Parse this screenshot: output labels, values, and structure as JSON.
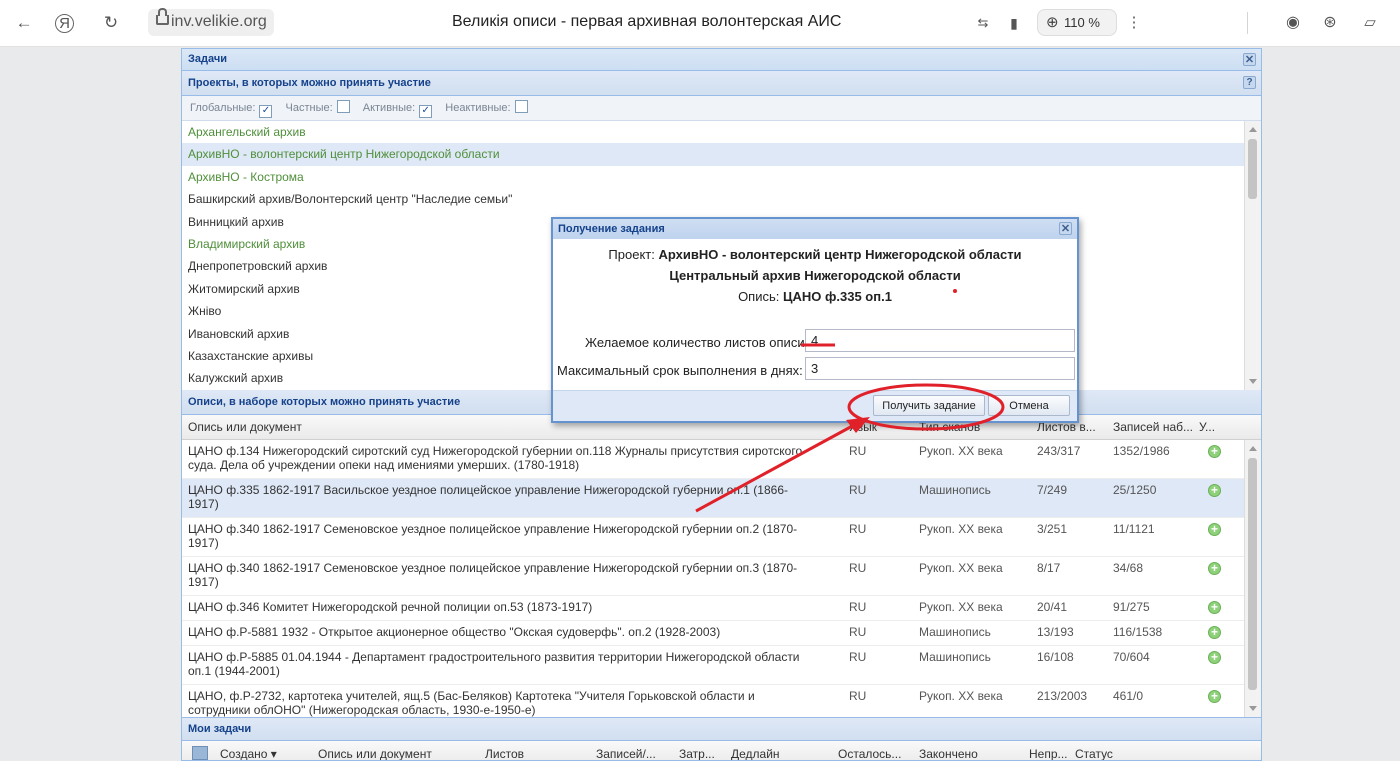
{
  "browser": {
    "url": "inv.velikie.org",
    "page_title": "Великія описи - первая архивная волонтерская АИС",
    "zoom": "110 %",
    "icons": [
      "back-icon",
      "yandex-logo-icon",
      "reload-icon",
      "lock-icon",
      "translate-icon",
      "bookmark-icon",
      "zoom-icon",
      "more-icon",
      "alice-icon",
      "globe-icon",
      "extension-icon"
    ]
  },
  "window": {
    "title": "Задачи",
    "projects_panel": {
      "title": "Проекты, в которых можно принять участие",
      "help": "?",
      "filters": [
        {
          "label": "Глобальные:",
          "checked": true
        },
        {
          "label": "Частные:",
          "checked": false
        },
        {
          "label": "Активные:",
          "checked": true
        },
        {
          "label": "Неактивные:",
          "checked": false
        }
      ],
      "projects": [
        {
          "name": "Архангельский архив",
          "active": true
        },
        {
          "name": "АрхивНО - волонтерский центр Нижегородской области",
          "active": true,
          "selected": true
        },
        {
          "name": "АрхивНО - Кострома",
          "active": true
        },
        {
          "name": "Башкирский архив/Волонтерский центр \"Наследие семьи\"",
          "active": false
        },
        {
          "name": "Винницкий архив",
          "active": false
        },
        {
          "name": "Владимирский архив",
          "active": true
        },
        {
          "name": "Днепропетровский архив",
          "active": false
        },
        {
          "name": "Житомирский архив",
          "active": false
        },
        {
          "name": "Жнiво",
          "active": false
        },
        {
          "name": "Ивановский архив",
          "active": false
        },
        {
          "name": "Казахстанские архивы",
          "active": false
        },
        {
          "name": "Калужский архив",
          "active": false
        }
      ]
    },
    "inventories_panel": {
      "title": "Описи, в наборе которых можно принять участие",
      "columns": [
        "Опись или документ",
        "Язык",
        "Тип сканов",
        "Листов в...",
        "Записей наб...",
        "У..."
      ],
      "rows": [
        {
          "doc": "ЦАНО ф.134 Нижегородский сиротский суд Нижегородской губернии оп.118 Журналы присутствия сиротского суда. Дела об учреждении опеки над имениями умерших. (1780-1918)",
          "lang": "RU",
          "scan": "Рукоп. XX века",
          "sheets": "243/317",
          "records": "1352/1986",
          "selected": false
        },
        {
          "doc": "ЦАНО ф.335 1862-1917 Васильское уездное полицейское управление Нижегородской губернии оп.1 (1866-1917)",
          "lang": "RU",
          "scan": "Машинопись",
          "sheets": "7/249",
          "records": "25/1250",
          "selected": true
        },
        {
          "doc": "ЦАНО ф.340 1862-1917 Семеновское уездное полицейское управление Нижегородской губернии оп.2 (1870-1917)",
          "lang": "RU",
          "scan": "Рукоп. XX века",
          "sheets": "3/251",
          "records": "11/1121",
          "selected": false
        },
        {
          "doc": "ЦАНО ф.340 1862-1917 Семеновское уездное полицейское управление Нижегородской губернии оп.3 (1870-1917)",
          "lang": "RU",
          "scan": "Рукоп. XX века",
          "sheets": "8/17",
          "records": "34/68",
          "selected": false
        },
        {
          "doc": "ЦАНО ф.346 Комитет Нижегородской речной полиции оп.53 (1873-1917)",
          "lang": "RU",
          "scan": "Рукоп. XX века",
          "sheets": "20/41",
          "records": "91/275",
          "selected": false
        },
        {
          "doc": "ЦАНО ф.Р-5881 1932 - Открытое акционерное общество \"Окская судоверфь\". оп.2 (1928-2003)",
          "lang": "RU",
          "scan": "Машинопись",
          "sheets": "13/193",
          "records": "116/1538",
          "selected": false
        },
        {
          "doc": "ЦАНО ф.Р-5885 01.04.1944 - Департамент градостроительного развития территории Нижегородской области оп.1 (1944-2001)",
          "lang": "RU",
          "scan": "Машинопись",
          "sheets": "16/108",
          "records": "70/604",
          "selected": false
        },
        {
          "doc": "ЦАНО, ф.Р-2732, картотека учителей, ящ.5 (Бас-Беляков) Картотека \"Учителя Горьковской области и сотрудники облОНО\" (Нижегородская область, 1930-е-1950-е)",
          "lang": "RU",
          "scan": "Рукоп. XX века",
          "sheets": "213/2003",
          "records": "461/0",
          "selected": false
        }
      ]
    },
    "my_tasks": {
      "title": "Мои задачи",
      "columns": [
        "Создано",
        "Опись или документ",
        "Листов",
        "Записей/...",
        "Затр...",
        "Дедлайн",
        "Осталось...",
        "Закончено",
        "Непр...",
        "Статус"
      ]
    }
  },
  "dialog": {
    "title": "Получение задания",
    "project_label": "Проект:",
    "project_value": "АрхивНО - волонтерский центр Нижегородской области",
    "archive": "Центральный архив Нижегородской области",
    "inventory_label": "Опись:",
    "inventory_value": "ЦАНО ф.335 оп.1",
    "sheets_label": "Желаемое количество листов описи:",
    "sheets_value": "4",
    "days_label": "Максимальный срок выполнения в днях:",
    "days_value": "3",
    "ok_label": "Получить задание",
    "cancel_label": "Отмена"
  },
  "colors": {
    "annotation_red": "#e0212a",
    "panel_header_text": "#15428b",
    "active_project": "#4f8f3a"
  }
}
